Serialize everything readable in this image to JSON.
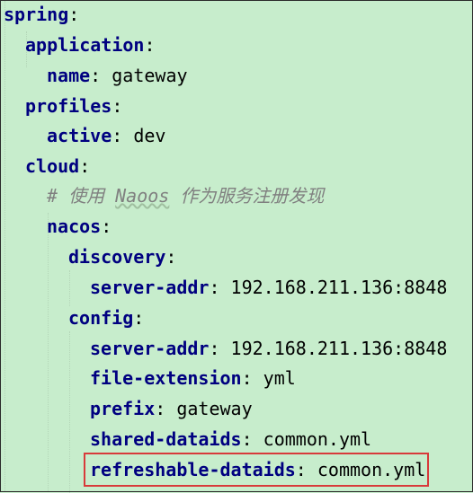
{
  "yaml": {
    "spring": "spring",
    "application": "application",
    "name": "name",
    "name_value": "gateway",
    "profiles": "profiles",
    "active": "active",
    "active_value": "dev",
    "cloud": "cloud",
    "comment_prefix": "# 使用 ",
    "comment_word": "Naoos",
    "comment_suffix": " 作为服务注册发现",
    "nacos": "nacos",
    "discovery": "discovery",
    "discovery_server_addr_key": "server-addr",
    "discovery_server_addr_value": "192.168.211.136:8848",
    "config": "config",
    "config_server_addr_key": "server-addr",
    "config_server_addr_value": "192.168.211.136:8848",
    "file_extension_key": "file-extension",
    "file_extension_value": "yml",
    "prefix_key": "prefix",
    "prefix_value": "gateway",
    "shared_dataids_key": "shared-dataids",
    "shared_dataids_value": "common.yml",
    "refreshable_dataids_key": "refreshable-dataids",
    "refreshable_dataids_value": "common.yml",
    "colon": ":"
  },
  "colors": {
    "background": "#c7edcc",
    "key": "#000080",
    "comment": "#808080",
    "highlight_border": "#d83a3a"
  }
}
